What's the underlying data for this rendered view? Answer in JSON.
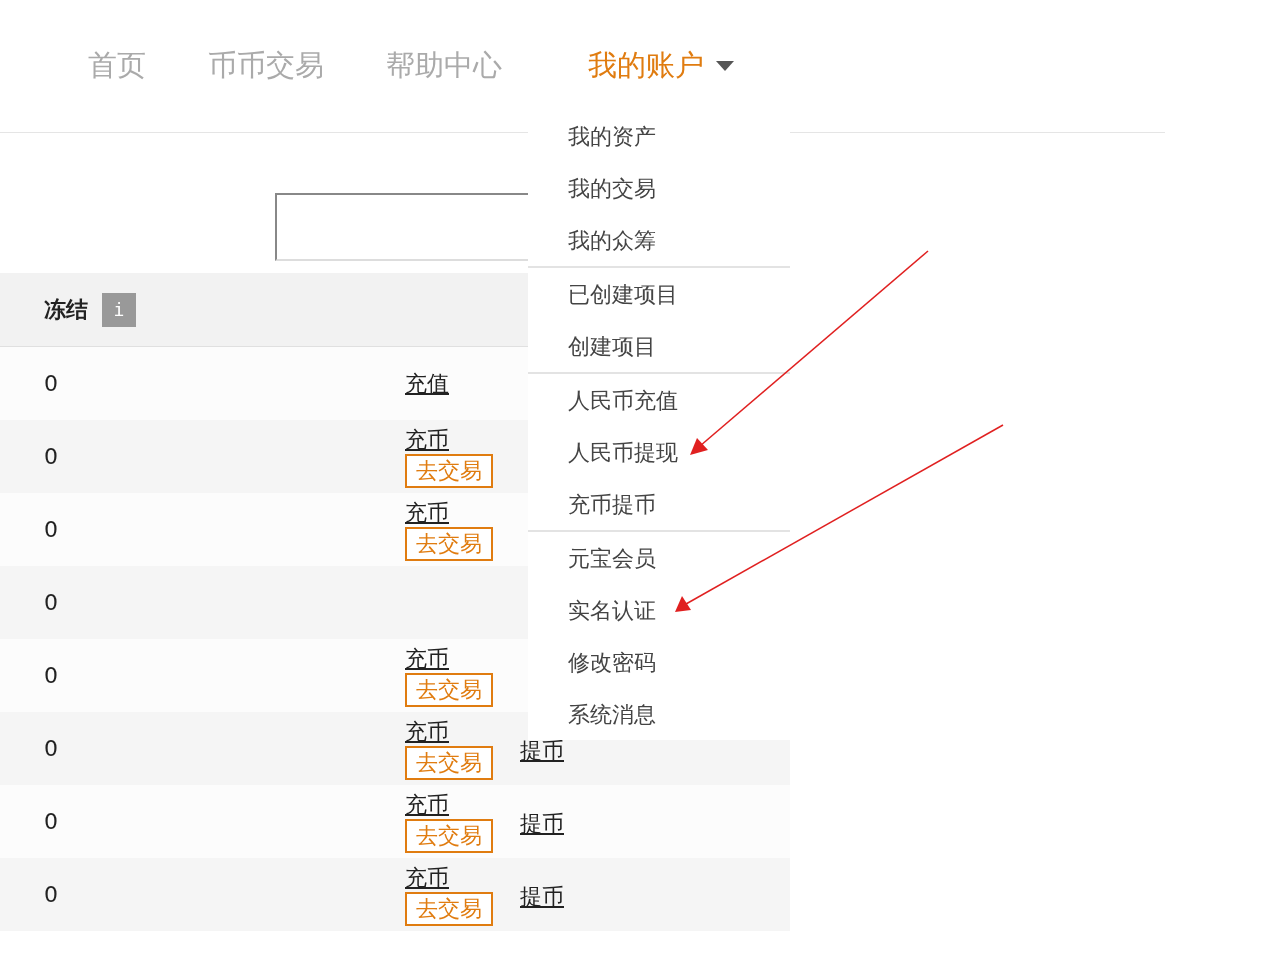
{
  "nav": [
    {
      "label": "首页",
      "selected": false,
      "dropdown": false
    },
    {
      "label": "币币交易",
      "selected": false,
      "dropdown": false
    },
    {
      "label": "帮助中心",
      "selected": false,
      "dropdown": false
    },
    {
      "label": "我的账户",
      "selected": true,
      "dropdown": true
    }
  ],
  "table": {
    "columns": [
      {
        "label": "冻结",
        "info": "i"
      }
    ],
    "rows": [
      {
        "frozen": "0",
        "deposit": "充值"
      },
      {
        "frozen": "0",
        "deposit": "充币",
        "trade": "去交易"
      },
      {
        "frozen": "0",
        "deposit": "充币",
        "trade": "去交易"
      },
      {
        "frozen": "0"
      },
      {
        "frozen": "0",
        "deposit": "充币",
        "trade": "去交易"
      },
      {
        "frozen": "0",
        "deposit": "充币",
        "trade": "去交易",
        "withdraw": "提币"
      },
      {
        "frozen": "0",
        "deposit": "充币",
        "trade": "去交易",
        "withdraw": "提币"
      },
      {
        "frozen": "0",
        "deposit": "充币",
        "trade": "去交易",
        "withdraw": "提币"
      }
    ]
  },
  "account_menu": [
    [
      "我的资产",
      "我的交易",
      "我的众筹"
    ],
    [
      "已创建项目",
      "创建项目"
    ],
    [
      "人民币充值",
      "人民币提现",
      "充币提币"
    ],
    [
      "元宝会员",
      "实名认证",
      "修改密码",
      "系统消息"
    ]
  ]
}
